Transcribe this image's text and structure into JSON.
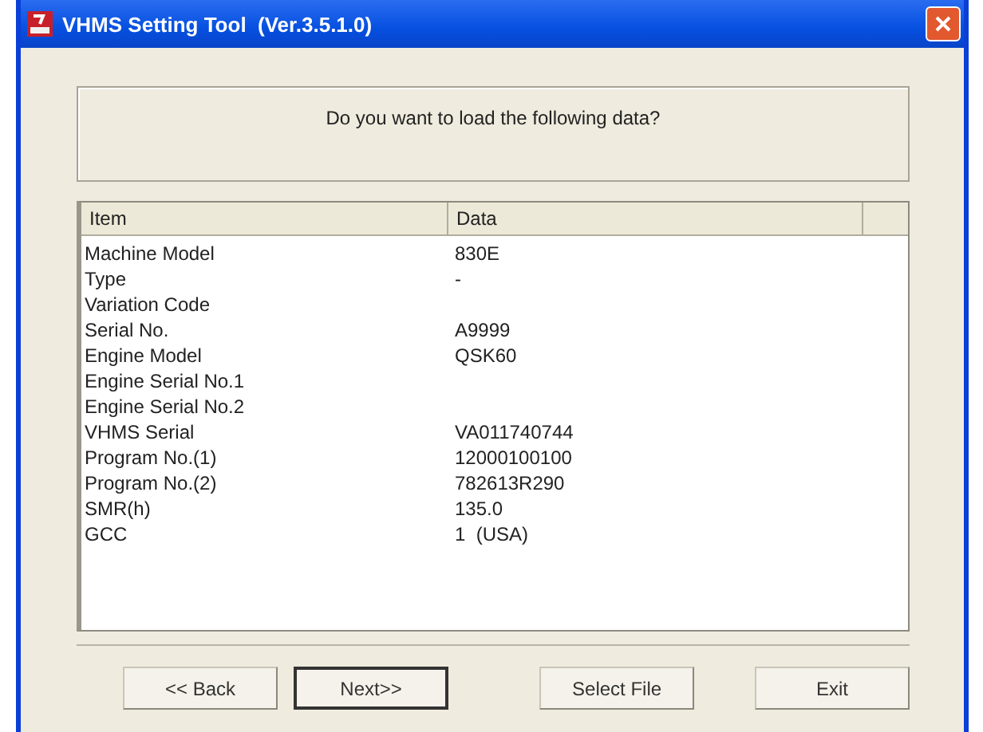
{
  "window": {
    "title": "VHMS Setting Tool  (Ver.3.5.1.0)"
  },
  "message": "Do you want to load the following data?",
  "table": {
    "columns": [
      "Item",
      "Data"
    ],
    "rows": [
      {
        "item": "Machine Model",
        "data": "830E"
      },
      {
        "item": "Type",
        "data": "-"
      },
      {
        "item": "Variation Code",
        "data": ""
      },
      {
        "item": "Serial No.",
        "data": "A9999"
      },
      {
        "item": "Engine Model",
        "data": "QSK60"
      },
      {
        "item": "Engine Serial No.1",
        "data": ""
      },
      {
        "item": "Engine Serial No.2",
        "data": ""
      },
      {
        "item": "VHMS Serial",
        "data": "VA011740744"
      },
      {
        "item": "Program No.(1)",
        "data": "12000100100"
      },
      {
        "item": "Program No.(2)",
        "data": "782613R290"
      },
      {
        "item": "SMR(h)",
        "data": "135.0"
      },
      {
        "item": "GCC",
        "data": "1  (USA)"
      }
    ]
  },
  "buttons": [
    {
      "label": "<< Back",
      "default": false
    },
    {
      "label": "Next>>",
      "default": true
    },
    {
      "label": "Select File",
      "default": false
    },
    {
      "label": "Exit",
      "default": false
    }
  ]
}
